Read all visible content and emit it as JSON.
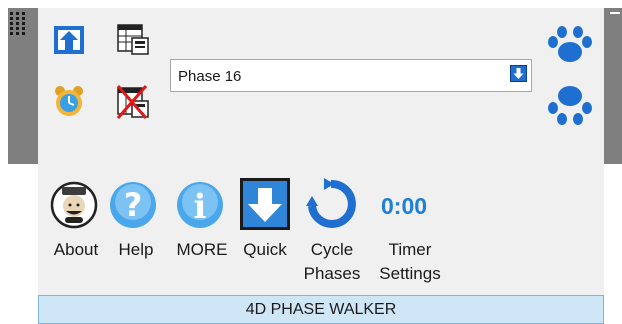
{
  "phase_select": {
    "value": "Phase 16"
  },
  "toolbar": {
    "about": "About",
    "help": "Help",
    "more": "MORE",
    "quick": "Quick",
    "cycle_line1": "Cycle",
    "cycle_line2": "Phases",
    "timer_line1": "Timer",
    "timer_line2": "Settings",
    "timer_value": "0:00"
  },
  "footer": {
    "title": "4D PHASE WALKER"
  },
  "colors": {
    "accent": "#1e7fd6",
    "footer_bg": "#cfe6f7",
    "panel_bg": "#f0f0f0"
  },
  "icons": [
    "export-icon",
    "schedule-table-icon",
    "alarm-clock-icon",
    "schedule-delete-icon",
    "paw-forward-icon",
    "paw-back-icon",
    "about-avatar-icon",
    "help-icon",
    "info-icon",
    "quick-down-arrow-icon",
    "cycle-refresh-icon"
  ]
}
